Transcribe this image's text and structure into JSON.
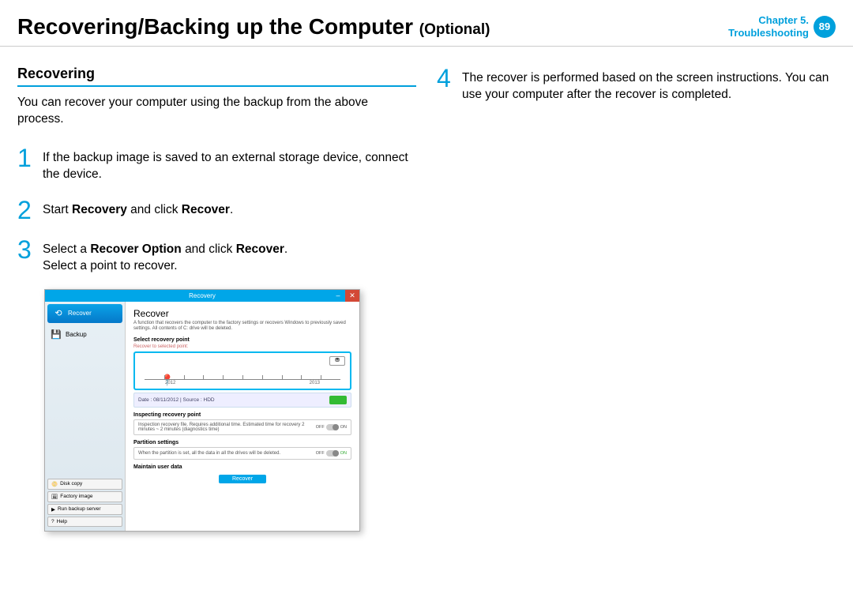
{
  "header": {
    "title": "Recovering/Backing up the Computer",
    "optional": "(Optional)",
    "chapter": "Chapter 5.",
    "section": "Troubleshooting",
    "page": "89"
  },
  "left": {
    "section": "Recovering",
    "intro": "You can recover your computer using the backup from the above process.",
    "s1": "If the backup image is saved to an external storage device, connect the device.",
    "s2a": "Start",
    "s2b": "Recovery",
    "s2c": "and click",
    "s2d": "Recover",
    "s2e": ".",
    "s3a": "Select a",
    "s3b": "Recover Option",
    "s3c": "and click",
    "s3d": "Recover",
    "s3e": ".",
    "s3f": "Select a point to recover."
  },
  "right": {
    "s4": "The recover is performed based on the screen instructions. You can use your computer after the recover is completed."
  },
  "app": {
    "title": "Recovery",
    "side": {
      "recover": "Recover",
      "backup": "Backup",
      "disk": "Disk copy",
      "factory": "Factory image",
      "run": "Run backup server",
      "help": "Help"
    },
    "main": {
      "h": "Recover",
      "d": "A function that recovers the computer to the factory settings or recovers Windows to previously saved settings. All contents of C: drive will be deleted.",
      "srp": "Select recovery point",
      "srpd": "Recover to selected point:",
      "y1": "2012",
      "y2": "2013",
      "info": "Date :  08/11/2012   |   Source :   HDD",
      "irp": "Inspecting recovery point",
      "irpd": "Inspection recovery file. Requires additional time. Estimated time for recovery 2 minutes ~ 2 minutes (diagnostics time)",
      "ps": "Partition settings",
      "psd": "When the partition is set, all the data in all the drives will be deleted.",
      "mud": "Maintain user data",
      "off": "OFF",
      "on": "ON",
      "btn": "Recover"
    }
  }
}
